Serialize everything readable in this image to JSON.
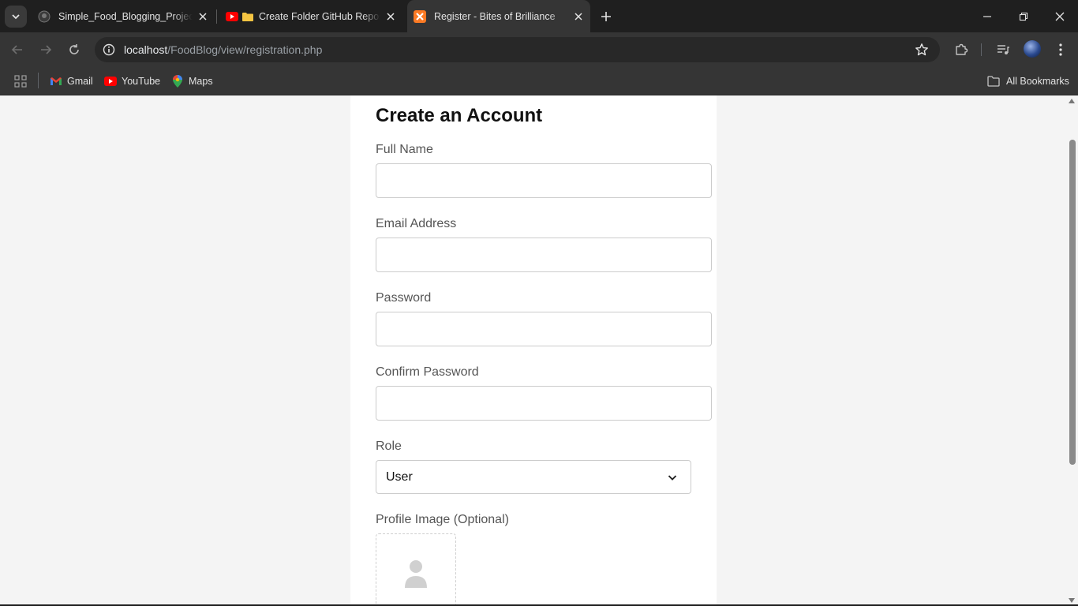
{
  "browser": {
    "tabs": [
      {
        "title": "Simple_Food_Blogging_Project/",
        "favicon": "github-icon",
        "active": false
      },
      {
        "title": "Create Folder GitHub Repos",
        "favicon": "youtube-folder-icon",
        "active": false
      },
      {
        "title": "Register - Bites of Brilliance",
        "favicon": "xampp-icon",
        "active": true
      }
    ],
    "url": {
      "host": "localhost",
      "path": "/FoodBlog/view/registration.php"
    },
    "bookmarks": [
      {
        "label": "Gmail",
        "icon": "gmail-icon"
      },
      {
        "label": "YouTube",
        "icon": "youtube-icon"
      },
      {
        "label": "Maps",
        "icon": "maps-icon"
      }
    ],
    "all_bookmarks_label": "All Bookmarks",
    "colors": {
      "tab_strip": "#1f1f1f",
      "toolbar": "#353535",
      "omnibox": "#282828",
      "xampp_orange": "#fb7a24",
      "youtube_red": "#ff0000",
      "folder_yellow": "#f5c542"
    }
  },
  "form": {
    "heading": "Create an Account",
    "fields": {
      "full_name": {
        "label": "Full Name",
        "value": ""
      },
      "email": {
        "label": "Email Address",
        "value": ""
      },
      "password": {
        "label": "Password",
        "value": ""
      },
      "confirm_password": {
        "label": "Confirm Password",
        "value": ""
      },
      "role": {
        "label": "Role",
        "selected": "User"
      },
      "profile_image": {
        "label": "Profile Image (Optional)",
        "icon": "person-placeholder-icon"
      }
    },
    "colors": {
      "page_bg": "#f4f4f4",
      "card_bg": "#ffffff",
      "label": "#555555",
      "heading": "#111111",
      "input_border": "#cccccc"
    }
  }
}
